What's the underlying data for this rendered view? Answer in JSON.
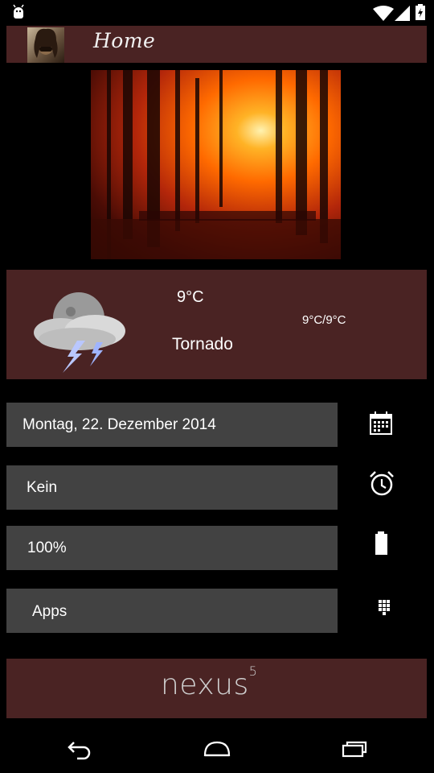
{
  "status_bar": {
    "left_icon": "android-debug-icon",
    "icons": [
      "wifi-icon",
      "signal-icon",
      "battery-charging-icon"
    ]
  },
  "header": {
    "avatar": "profile-photo",
    "title": "Home"
  },
  "weather": {
    "icon": "thunderstorm-cloud-icon",
    "temperature": "9°C",
    "range": "9°C/9°C",
    "condition": "Tornado"
  },
  "rows": [
    {
      "label": "Montag, 22. Dezember 2014",
      "icon": "calendar-icon"
    },
    {
      "label": "Kein",
      "icon": "alarm-clock-icon"
    },
    {
      "label": "100%",
      "icon": "battery-icon"
    },
    {
      "label": "Apps",
      "icon": "app-grid-icon"
    }
  ],
  "footer": {
    "brand": "nexus",
    "superscript": "5"
  },
  "nav_bar": {
    "buttons": [
      "back-button",
      "home-button",
      "recents-button"
    ]
  },
  "colors": {
    "panel": "#4a2323",
    "row": "#424242",
    "background": "#000000"
  }
}
